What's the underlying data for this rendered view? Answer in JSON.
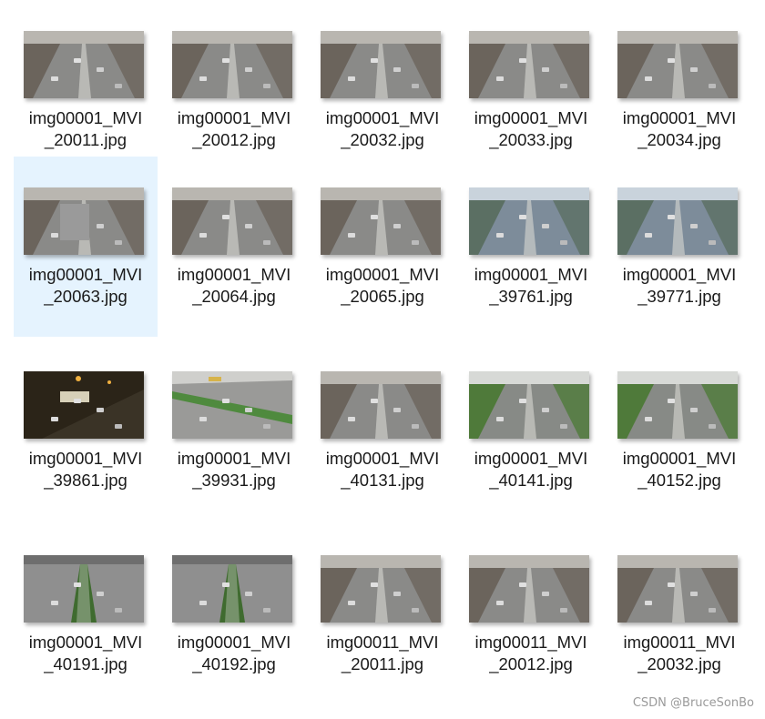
{
  "files": [
    {
      "name_line1": "img00001_MVI",
      "name_line2": "_20011.jpg",
      "scene": "gray",
      "selected": false
    },
    {
      "name_line1": "img00001_MVI",
      "name_line2": "_20012.jpg",
      "scene": "gray",
      "selected": false
    },
    {
      "name_line1": "img00001_MVI",
      "name_line2": "_20032.jpg",
      "scene": "gray",
      "selected": false
    },
    {
      "name_line1": "img00001_MVI",
      "name_line2": "_20033.jpg",
      "scene": "gray",
      "selected": false
    },
    {
      "name_line1": "img00001_MVI",
      "name_line2": "_20034.jpg",
      "scene": "gray",
      "selected": false
    },
    {
      "name_line1": "img00001_MVI",
      "name_line2": "_20063.jpg",
      "scene": "gray-bus",
      "selected": true
    },
    {
      "name_line1": "img00001_MVI",
      "name_line2": "_20064.jpg",
      "scene": "gray",
      "selected": false
    },
    {
      "name_line1": "img00001_MVI",
      "name_line2": "_20065.jpg",
      "scene": "gray",
      "selected": false
    },
    {
      "name_line1": "img00001_MVI",
      "name_line2": "_39761.jpg",
      "scene": "blue",
      "selected": false
    },
    {
      "name_line1": "img00001_MVI",
      "name_line2": "_39771.jpg",
      "scene": "blue",
      "selected": false
    },
    {
      "name_line1": "img00001_MVI",
      "name_line2": "_39861.jpg",
      "scene": "night",
      "selected": false
    },
    {
      "name_line1": "img00001_MVI",
      "name_line2": "_39931.jpg",
      "scene": "green-diag",
      "selected": false
    },
    {
      "name_line1": "img00001_MVI",
      "name_line2": "_40131.jpg",
      "scene": "gray",
      "selected": false
    },
    {
      "name_line1": "img00001_MVI",
      "name_line2": "_40141.jpg",
      "scene": "green",
      "selected": false
    },
    {
      "name_line1": "img00001_MVI",
      "name_line2": "_40152.jpg",
      "scene": "green",
      "selected": false
    },
    {
      "name_line1": "img00001_MVI",
      "name_line2": "_40191.jpg",
      "scene": "highway",
      "selected": false
    },
    {
      "name_line1": "img00001_MVI",
      "name_line2": "_40192.jpg",
      "scene": "highway",
      "selected": false
    },
    {
      "name_line1": "img00011_MVI",
      "name_line2": "_20011.jpg",
      "scene": "gray",
      "selected": false
    },
    {
      "name_line1": "img00011_MVI",
      "name_line2": "_20012.jpg",
      "scene": "gray",
      "selected": false
    },
    {
      "name_line1": "img00011_MVI",
      "name_line2": "_20032.jpg",
      "scene": "gray",
      "selected": false
    }
  ],
  "watermark": "CSDN @BruceSonBo",
  "colors": {
    "selection": "#e5f3fe",
    "road_gray": "#8a8a88",
    "road_blue": "#7d8c9a",
    "night": "#2b2418",
    "foliage": "#4f7a3a"
  }
}
